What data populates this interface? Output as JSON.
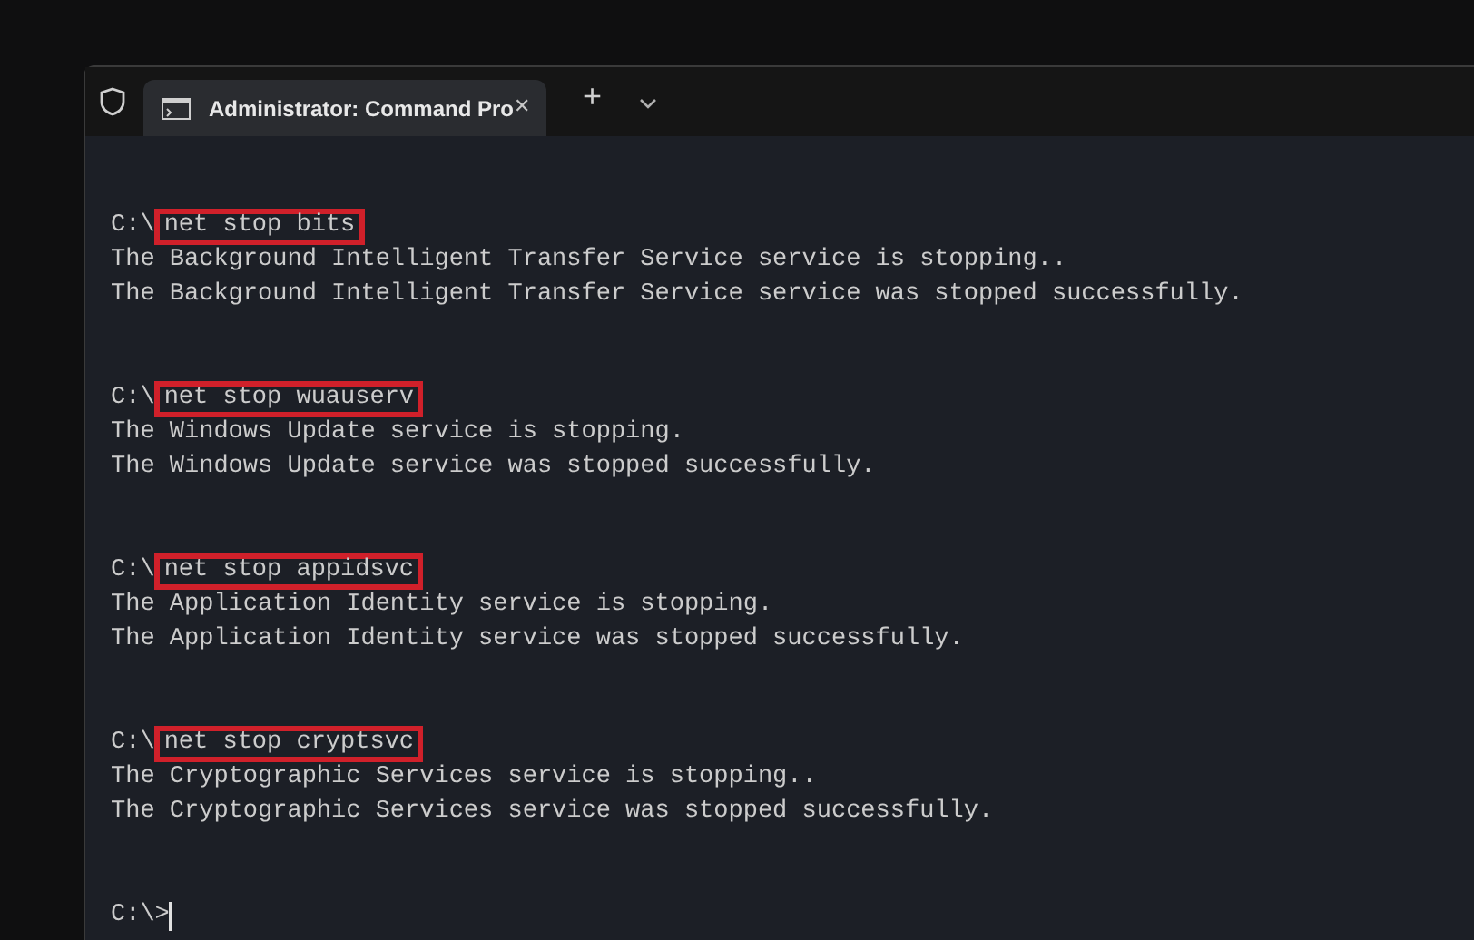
{
  "tabs": [
    {
      "title": "Administrator: Command Pro",
      "selected": true,
      "close": "✕"
    }
  ],
  "new_tab": "+",
  "terminal_lines": [
    {
      "kind": "blank"
    },
    {
      "kind": "blank"
    },
    {
      "kind": "command",
      "prompt": "C:\\",
      "command": "net stop bits",
      "highlighted": true
    },
    {
      "kind": "output",
      "text": "The Background Intelligent Transfer Service service is stopping.."
    },
    {
      "kind": "output",
      "text": "The Background Intelligent Transfer Service service was stopped successfully."
    },
    {
      "kind": "blank"
    },
    {
      "kind": "blank"
    },
    {
      "kind": "command",
      "prompt": "C:\\",
      "command": "net stop wuauserv",
      "highlighted": true
    },
    {
      "kind": "output",
      "text": "The Windows Update service is stopping."
    },
    {
      "kind": "output",
      "text": "The Windows Update service was stopped successfully."
    },
    {
      "kind": "blank"
    },
    {
      "kind": "blank"
    },
    {
      "kind": "command",
      "prompt": "C:\\",
      "command": "net stop appidsvc",
      "highlighted": true
    },
    {
      "kind": "output",
      "text": "The Application Identity service is stopping."
    },
    {
      "kind": "output",
      "text": "The Application Identity service was stopped successfully."
    },
    {
      "kind": "blank"
    },
    {
      "kind": "blank"
    },
    {
      "kind": "command",
      "prompt": "C:\\",
      "command": "net stop cryptsvc",
      "highlighted": true
    },
    {
      "kind": "output",
      "text": "The Cryptographic Services service is stopping.."
    },
    {
      "kind": "output",
      "text": "The Cryptographic Services service was stopped successfully."
    },
    {
      "kind": "blank"
    },
    {
      "kind": "blank"
    },
    {
      "kind": "prompt",
      "prompt": "C:\\>",
      "cursor": true
    }
  ]
}
